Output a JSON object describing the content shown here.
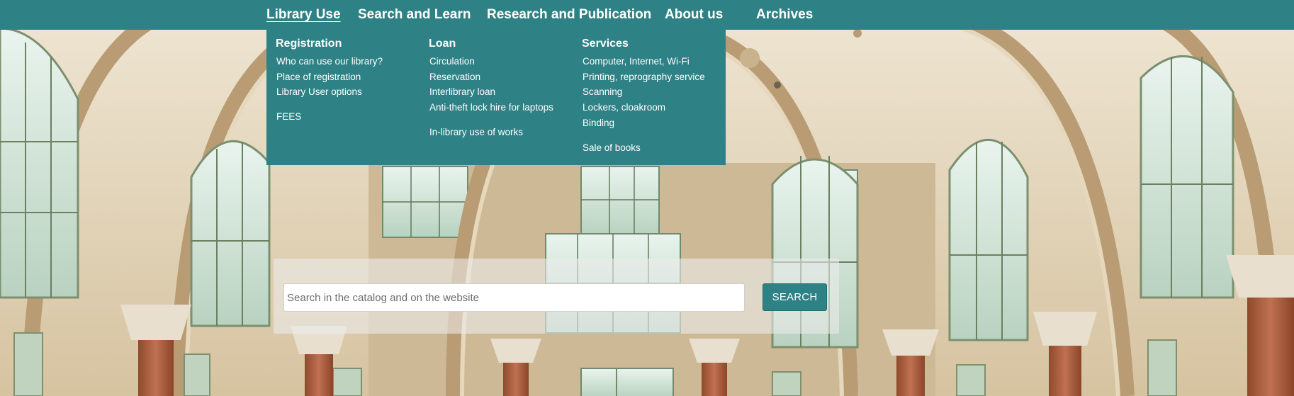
{
  "nav": {
    "items": [
      {
        "label": "Library Use",
        "active": true
      },
      {
        "label": "Search and Learn",
        "active": false
      },
      {
        "label": "Research and Publication",
        "active": false
      },
      {
        "label": "About us",
        "active": false
      },
      {
        "label": "Archives",
        "active": false
      }
    ]
  },
  "dropdown": {
    "columns": [
      {
        "heading": "Registration",
        "links": [
          "Who can use our library?",
          "Place of registration",
          "Library User options",
          "FEES"
        ]
      },
      {
        "heading": "Loan",
        "links": [
          "Circulation",
          "Reservation",
          "Interlibrary loan",
          "Anti-theft lock hire for laptops",
          "In-library use of works"
        ]
      },
      {
        "heading": "Services",
        "links": [
          "Computer, Internet, Wi-Fi",
          "Printing, reprography service",
          "Scanning",
          "Lockers, cloakroom",
          "Binding",
          "Sale of books"
        ]
      }
    ]
  },
  "search": {
    "placeholder": "Search in the catalog and on the website",
    "button_label": "SEARCH"
  },
  "colors": {
    "brand_teal": "#2e8185",
    "text_white": "#ffffff"
  }
}
